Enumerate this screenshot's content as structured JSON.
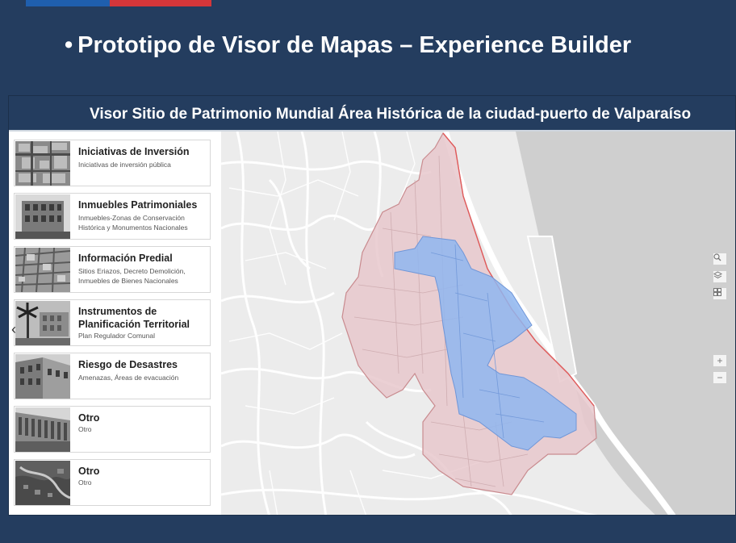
{
  "slide": {
    "bullet": "•",
    "title": "Prototipo de Visor de Mapas – Experience Builder"
  },
  "app": {
    "title": "Visor Sitio de Patrimonio Mundial Área Histórica de la ciudad-puerto de Valparaíso"
  },
  "sidebar": {
    "items": [
      {
        "title": "Iniciativas de Inversión",
        "subtitle": "Iniciativas de inversión pública"
      },
      {
        "title": "Inmuebles Patrimoniales",
        "subtitle": "Inmuebles-Zonas de Conservación Histórica y Monumentos Nacionales"
      },
      {
        "title": "Información Predial",
        "subtitle": "Sitios Eriazos, Decreto Demolición, Inmuebles de Bienes Nacionales"
      },
      {
        "title": "Instrumentos de Planificación Territorial",
        "subtitle": "Plan Regulador Comunal"
      },
      {
        "title": "Riesgo de Desastres",
        "subtitle": "Amenazas, Áreas de evacuación"
      },
      {
        "title": "Otro",
        "subtitle": "Otro"
      },
      {
        "title": "Otro",
        "subtitle": "Otro"
      }
    ]
  },
  "controls": {
    "collapse_left": "‹",
    "collapse_mid": "‹",
    "search_icon": "search-icon",
    "layers_icon": "layers-icon",
    "basemap_icon": "basemap-gallery-icon",
    "zoom_in": "+",
    "zoom_out": "−"
  },
  "colors": {
    "slide_bg": "#243d5f",
    "heritage_zone": "#e8c8cc",
    "heritage_outline": "#e05a5a",
    "core_zone": "#8fb6f0",
    "sea": "#cfcfcf"
  }
}
